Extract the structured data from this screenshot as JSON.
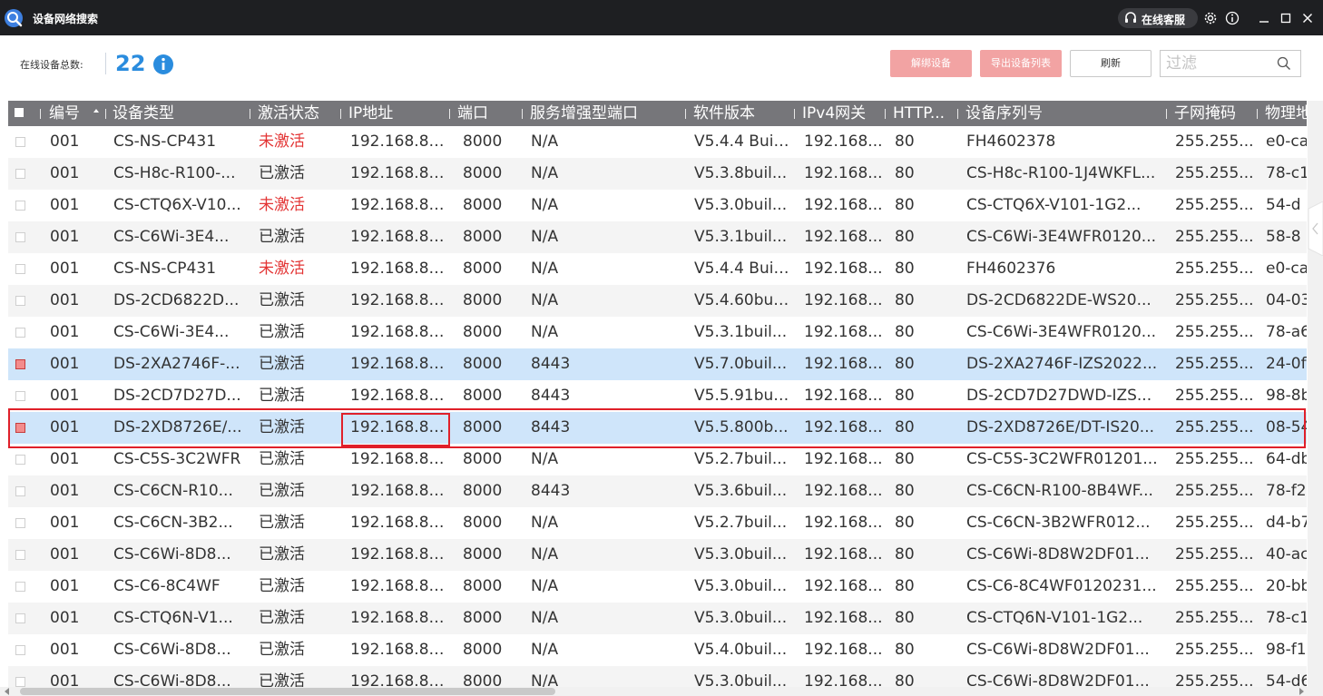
{
  "window": {
    "title": "设备网络搜索",
    "service_label": "在线客服"
  },
  "toolbar": {
    "online_count_label": "在线设备总数:",
    "online_count": "22",
    "btn_unbind": "解绑设备",
    "btn_export": "导出设备列表",
    "btn_refresh": "刷新",
    "filter_placeholder": "过滤"
  },
  "colors": {
    "title_bar": "#1e1f22",
    "accent": "#2a8cde",
    "danger_button": "#f2a3a3",
    "inactive_status": "#e33434",
    "selected_row": "#cfe5fa",
    "highlight_box": "#e0202a",
    "header_bg": "#76767a"
  },
  "table": {
    "headers": [
      "编号",
      "设备类型",
      "激活状态",
      "IP地址",
      "端口",
      "服务增强型端口",
      "软件版本",
      "IPv4网关",
      "HTTP...",
      "设备序列号",
      "子网掩码",
      "物理地"
    ],
    "rows": [
      {
        "checked": false,
        "id": "001",
        "type": "CS-NS-CP431",
        "status": "未激活",
        "ip": "192.168.8....",
        "port": "8000",
        "enhanced_port": "N/A",
        "version": "V5.4.4 Buil...",
        "gateway": "192.168...",
        "http": "80",
        "serial": "FH4602378",
        "mask": "255.255...",
        "mac": "e0-ca"
      },
      {
        "checked": false,
        "id": "001",
        "type": "CS-H8c-R100-...",
        "status": "已激活",
        "ip": "192.168.8....",
        "port": "8000",
        "enhanced_port": "N/A",
        "version": "V5.3.8buil...",
        "gateway": "192.168...",
        "http": "80",
        "serial": "CS-H8c-R100-1J4WKFL...",
        "mask": "255.255...",
        "mac": "78-c1"
      },
      {
        "checked": false,
        "id": "001",
        "type": "CS-CTQ6X-V10...",
        "status": "未激活",
        "ip": "192.168.8....",
        "port": "8000",
        "enhanced_port": "N/A",
        "version": "V5.3.0buil...",
        "gateway": "192.168...",
        "http": "80",
        "serial": "CS-CTQ6X-V101-1G2...",
        "mask": "255.255...",
        "mac": "54-d"
      },
      {
        "checked": false,
        "id": "001",
        "type": "CS-C6Wi-3E4...",
        "status": "已激活",
        "ip": "192.168.8....",
        "port": "8000",
        "enhanced_port": "N/A",
        "version": "V5.3.1buil...",
        "gateway": "192.168...",
        "http": "80",
        "serial": "CS-C6Wi-3E4WFR0120...",
        "mask": "255.255...",
        "mac": "58-8"
      },
      {
        "checked": false,
        "id": "001",
        "type": "CS-NS-CP431",
        "status": "未激活",
        "ip": "192.168.8....",
        "port": "8000",
        "enhanced_port": "N/A",
        "version": "V5.4.4 Buil...",
        "gateway": "192.168...",
        "http": "80",
        "serial": "FH4602376",
        "mask": "255.255...",
        "mac": "e0-ca"
      },
      {
        "checked": false,
        "id": "001",
        "type": "DS-2CD6822D...",
        "status": "已激活",
        "ip": "192.168.8....",
        "port": "8000",
        "enhanced_port": "N/A",
        "version": "V5.4.60bui...",
        "gateway": "192.168...",
        "http": "80",
        "serial": "DS-2CD6822DE-WS20...",
        "mask": "255.255...",
        "mac": "04-03"
      },
      {
        "checked": false,
        "id": "001",
        "type": "CS-C6Wi-3E4...",
        "status": "已激活",
        "ip": "192.168.8....",
        "port": "8000",
        "enhanced_port": "N/A",
        "version": "V5.3.1buil...",
        "gateway": "192.168...",
        "http": "80",
        "serial": "CS-C6Wi-3E4WFR0120...",
        "mask": "255.255...",
        "mac": "78-a6"
      },
      {
        "checked": true,
        "id": "001",
        "type": "DS-2XA2746F-...",
        "status": "已激活",
        "ip": "192.168.8....",
        "port": "8000",
        "enhanced_port": "8443",
        "version": "V5.7.0buil...",
        "gateway": "192.168...",
        "http": "80",
        "serial": "DS-2XA2746F-IZS2022...",
        "mask": "255.255...",
        "mac": "24-0f"
      },
      {
        "checked": false,
        "id": "001",
        "type": "DS-2CD7D27D...",
        "status": "已激活",
        "ip": "192.168.8....",
        "port": "8000",
        "enhanced_port": "8443",
        "version": "V5.5.91bui...",
        "gateway": "192.168...",
        "http": "80",
        "serial": "DS-2CD7D27DWD-IZS...",
        "mask": "255.255...",
        "mac": "98-8b"
      },
      {
        "checked": true,
        "id": "001",
        "type": "DS-2XD8726E/...",
        "status": "已激活",
        "ip": "192.168.8....",
        "port": "8000",
        "enhanced_port": "8443",
        "version": "V5.5.800b...",
        "gateway": "192.168...",
        "http": "80",
        "serial": "DS-2XD8726E/DT-IS20...",
        "mask": "255.255...",
        "mac": "08-54"
      },
      {
        "checked": false,
        "id": "001",
        "type": "CS-C5S-3C2WFR",
        "status": "已激活",
        "ip": "192.168.8....",
        "port": "8000",
        "enhanced_port": "N/A",
        "version": "V5.2.7buil...",
        "gateway": "192.168...",
        "http": "80",
        "serial": "CS-C5S-3C2WFR01201...",
        "mask": "255.255...",
        "mac": "64-db"
      },
      {
        "checked": false,
        "id": "001",
        "type": "CS-C6CN-R10...",
        "status": "已激活",
        "ip": "192.168.8....",
        "port": "8000",
        "enhanced_port": "8443",
        "version": "V5.3.6buil...",
        "gateway": "192.168...",
        "http": "80",
        "serial": "CS-C6CN-R100-8B4WF...",
        "mask": "255.255...",
        "mac": "78-f2"
      },
      {
        "checked": false,
        "id": "001",
        "type": "CS-C6CN-3B2...",
        "status": "已激活",
        "ip": "192.168.8....",
        "port": "8000",
        "enhanced_port": "N/A",
        "version": "V5.2.7buil...",
        "gateway": "192.168...",
        "http": "80",
        "serial": "CS-C6CN-3B2WFR012...",
        "mask": "255.255...",
        "mac": "d4-b7"
      },
      {
        "checked": false,
        "id": "001",
        "type": "CS-C6Wi-8D8...",
        "status": "已激活",
        "ip": "192.168.8....",
        "port": "8000",
        "enhanced_port": "N/A",
        "version": "V5.3.0buil...",
        "gateway": "192.168...",
        "http": "80",
        "serial": "CS-C6Wi-8D8W2DF01...",
        "mask": "255.255...",
        "mac": "40-ac"
      },
      {
        "checked": false,
        "id": "001",
        "type": "CS-C6-8C4WF",
        "status": "已激活",
        "ip": "192.168.8....",
        "port": "8000",
        "enhanced_port": "N/A",
        "version": "V5.3.0buil...",
        "gateway": "192.168...",
        "http": "80",
        "serial": "CS-C6-8C4WF0120231...",
        "mask": "255.255...",
        "mac": "20-bb"
      },
      {
        "checked": false,
        "id": "001",
        "type": "CS-CTQ6N-V1...",
        "status": "已激活",
        "ip": "192.168.8....",
        "port": "8000",
        "enhanced_port": "N/A",
        "version": "V5.3.0buil...",
        "gateway": "192.168...",
        "http": "80",
        "serial": "CS-CTQ6N-V101-1G2...",
        "mask": "255.255...",
        "mac": "78-c1"
      },
      {
        "checked": false,
        "id": "001",
        "type": "CS-C6Wi-8D8...",
        "status": "已激活",
        "ip": "192.168.8....",
        "port": "8000",
        "enhanced_port": "N/A",
        "version": "V5.4.0buil...",
        "gateway": "192.168...",
        "http": "80",
        "serial": "CS-C6Wi-8D8W2DF01...",
        "mask": "255.255...",
        "mac": "98-f1"
      },
      {
        "checked": false,
        "id": "001",
        "type": "CS-C6Wi-8D8...",
        "status": "已激活",
        "ip": "192.168.8....",
        "port": "8000",
        "enhanced_port": "N/A",
        "version": "V5.3.0buil...",
        "gateway": "192.168...",
        "http": "80",
        "serial": "CS-C6Wi-8D8W2DF01...",
        "mask": "255.255...",
        "mac": "54-d6"
      }
    ]
  }
}
